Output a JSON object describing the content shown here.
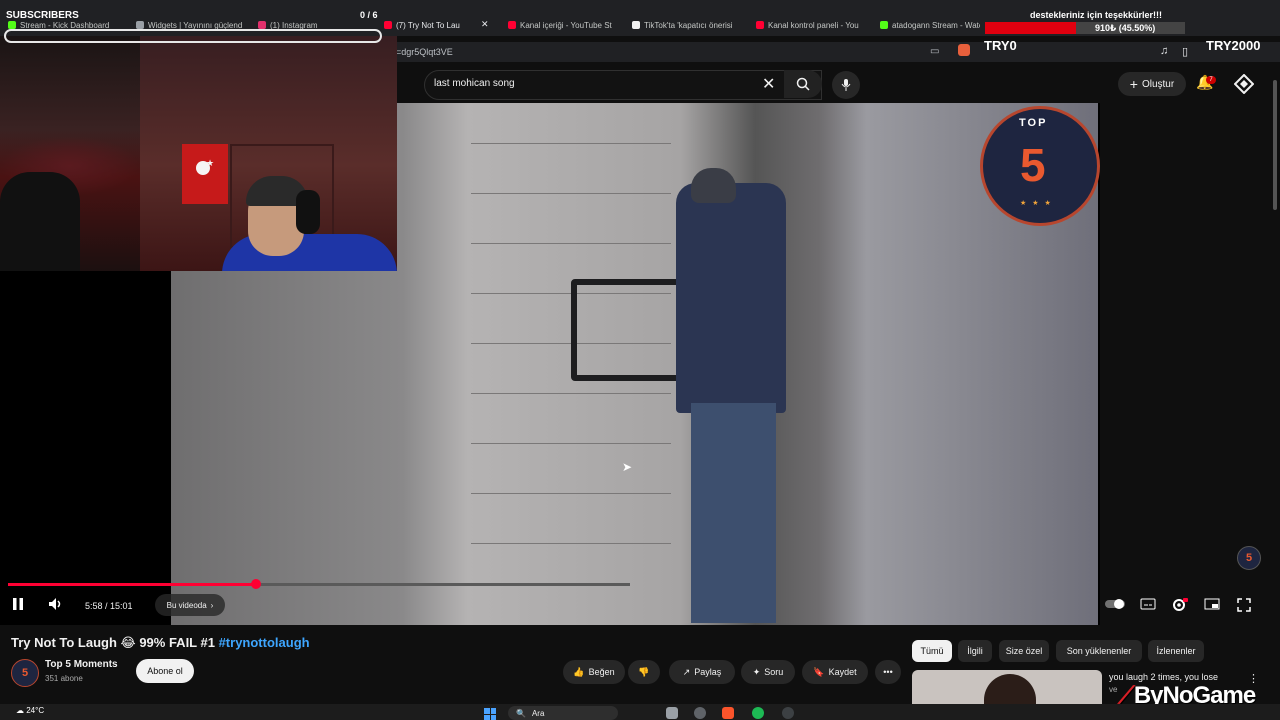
{
  "browser": {
    "tabs": [
      {
        "label": "Stream - Kick Dashboard",
        "fav_color": "#53fc18"
      },
      {
        "label": "Widgets | Yayınını güçlend",
        "fav_color": "#9aa0a6"
      },
      {
        "label": "(1) Instagram",
        "fav_color": "#e1306c"
      },
      {
        "label": "(7) Try Not To Lau",
        "fav_color": "#ff0033"
      },
      {
        "label": "Kanal içeriği - YouTube St",
        "fav_color": "#ff0033"
      },
      {
        "label": "TikTok'ta 'kapatıcı önerisi",
        "fav_color": "#f1f1f1"
      },
      {
        "label": "Kanal kontrol paneli - You",
        "fav_color": "#ff0033"
      },
      {
        "label": "atadogann Stream - Watc",
        "fav_color": "#53fc18"
      }
    ],
    "url": "=dgr5Qlqt3VE"
  },
  "youtube": {
    "search": {
      "value": "last mohican song"
    },
    "create_label": "Oluştur",
    "notification_count": "7"
  },
  "player": {
    "progress_fraction": 0.3986,
    "time_display": "5:58 / 15:01",
    "chapter_label": "Bu videoda",
    "top5_badge": {
      "word": "TOP",
      "number": "5",
      "stars": "★ ★ ★"
    },
    "watermark": "5"
  },
  "overlay": {
    "subscribers": {
      "label": "SUBSCRIBERS",
      "count": "0 / 6"
    },
    "donation": {
      "message": "destekleriniz için teşekkürler!!!",
      "amount": "910₺ (45.50%)",
      "progress_fraction": 0.455,
      "min_label": "TRY0",
      "max_label": "TRY2000"
    }
  },
  "video": {
    "title_text": "Try Not To Laugh 😂 99% FAIL #1 ",
    "title_tag": "#trynottolaugh",
    "channel": {
      "name": "Top 5 Moments",
      "subs": "351 abone",
      "avatar": "5"
    },
    "subscribe_label": "Abone ol",
    "actions": {
      "like": "Beğen",
      "share": "Paylaş",
      "ask": "Soru",
      "save": "Kaydet"
    }
  },
  "sidebar": {
    "chips": [
      "Tümü",
      "İlgili",
      "Size özel",
      "Son yüklenenler",
      "İzlenenler"
    ],
    "rec_title": "you laugh 2 times, you lose",
    "rec_sub": "ve"
  },
  "logo": {
    "name": "ByNoGame"
  },
  "taskbar": {
    "weather_temp": "24°C",
    "search_placeholder": "Ara"
  }
}
